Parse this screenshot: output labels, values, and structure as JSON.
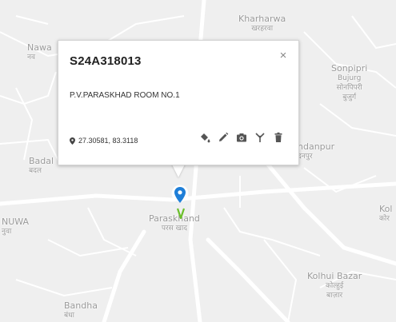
{
  "popup": {
    "title": "S24A318013",
    "address": "P.V.PARASKHAD ROOM NO.1",
    "coordinates": "27.30581, 83.3118",
    "close_glyph": "×",
    "actions": [
      "paint-bucket-icon",
      "pencil-icon",
      "camera-icon",
      "antenna-icon",
      "trash-icon"
    ]
  },
  "map": {
    "places": [
      {
        "name": "Kharharwa",
        "local": "खरहरवा"
      },
      {
        "name": "Nawa",
        "local": "नव"
      },
      {
        "name": "Sonpipri",
        "name2": "Bujurg",
        "local": "सोनपिपरी",
        "local2": "बुजुर्ग"
      },
      {
        "name": "ndanpur",
        "local": "दनपुर"
      },
      {
        "name": "Badal",
        "local": "बदल"
      },
      {
        "name": "Paraskhand",
        "local": "परस खाद"
      },
      {
        "name": "NUWA",
        "local": "नुवा"
      },
      {
        "name": "Kol",
        "local": "कोर"
      },
      {
        "name": "Kolhui Bazar",
        "local": "कोल्हुई",
        "local2": "बाज़ार"
      },
      {
        "name": "Bandha",
        "local": "बंधा"
      }
    ]
  },
  "colors": {
    "marker": "#1f7fd8",
    "road": "#ffffff",
    "map_bg": "#efefef",
    "tick": "#6bbf2b"
  }
}
